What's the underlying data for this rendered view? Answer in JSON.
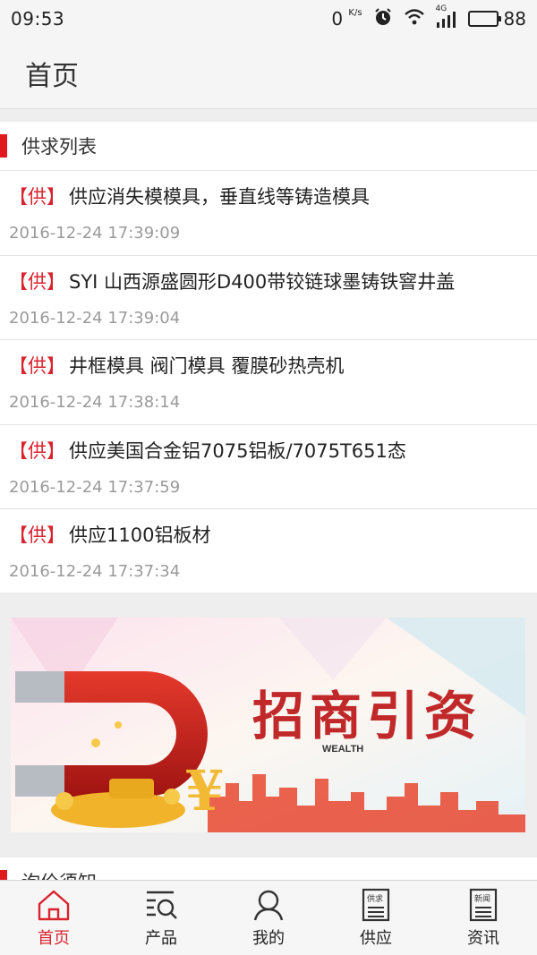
{
  "status": {
    "time": "09:53",
    "net_speed": "0",
    "net_unit": "K/s",
    "network_type": "4G",
    "battery": "88",
    "battery_level": 0.88,
    "icons": [
      "alarm-clock-icon",
      "wifi-icon",
      "signal-icon",
      "battery-icon"
    ]
  },
  "header": {
    "title": "首页"
  },
  "supply": {
    "section_title": "供求列表",
    "items": [
      {
        "tag": "【供】",
        "title": "供应消失模模具，垂直线等铸造模具",
        "time": "2016-12-24 17:39:09"
      },
      {
        "tag": "【供】",
        "title": "SYI 山西源盛圆形D400带铰链球墨铸铁窨井盖",
        "time": "2016-12-24 17:39:04"
      },
      {
        "tag": "【供】",
        "title": "井框模具 阀门模具 覆膜砂热壳机",
        "time": "2016-12-24 17:38:14"
      },
      {
        "tag": "【供】",
        "title": "供应美国合金铝7075铝板/7075T651态",
        "time": "2016-12-24 17:37:59"
      },
      {
        "tag": "【供】",
        "title": "供应1100铝板材",
        "time": "2016-12-24 17:37:34"
      }
    ]
  },
  "banner": {
    "headline": "招商引资",
    "brand": "WEALTH",
    "currency_symbol": "¥"
  },
  "notice": {
    "section_title": "询价须知"
  },
  "tabs": [
    {
      "label": "首页",
      "icon": "home-icon",
      "active": true
    },
    {
      "label": "产品",
      "icon": "product-search-icon",
      "active": false
    },
    {
      "label": "我的",
      "icon": "user-icon",
      "active": false
    },
    {
      "label": "供应",
      "icon": "supply-doc-icon",
      "active": false,
      "icon_text": "供求"
    },
    {
      "label": "资讯",
      "icon": "news-doc-icon",
      "active": false,
      "icon_text": "新闻"
    }
  ],
  "colors": {
    "accent": "#d9232e",
    "section_bar": "#e0191f",
    "muted": "#9a9a9a"
  }
}
